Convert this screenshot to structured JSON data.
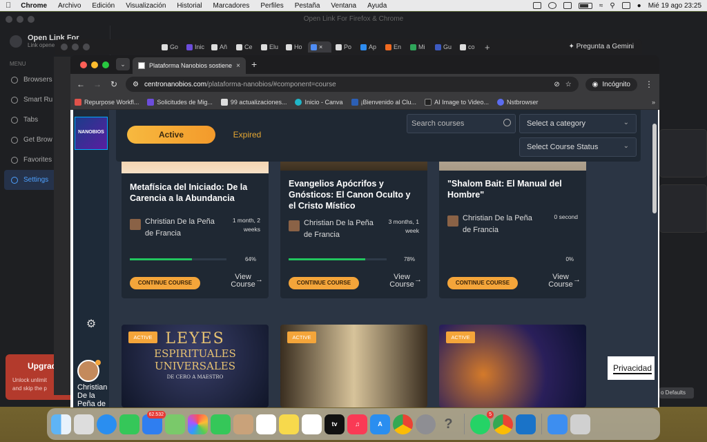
{
  "menubar": {
    "apple": "",
    "app": "Chrome",
    "menus": [
      "Archivo",
      "Edición",
      "Visualización",
      "Historial",
      "Marcadores",
      "Perfiles",
      "Pestaña",
      "Ventana",
      "Ayuda"
    ],
    "clock": "Mié 19 ago  23:25"
  },
  "bg_app": {
    "title": "Open Link For Firefox & Chrome",
    "brand_title": "Open Link For",
    "brand_subtitle": "Link opene",
    "menu_label": "MENU",
    "items": [
      "Browsers",
      "Smart Ru",
      "Tabs",
      "Get Brow",
      "Favorites",
      "Settings"
    ],
    "upgrade_title": "Upgrad",
    "upgrade_desc_1": "Unlock unlimit",
    "upgrade_desc_2": "and skip the p",
    "defaults_btn": "o Defaults"
  },
  "back_window": {
    "tabs": [
      "Go",
      "Inic",
      "Añ",
      "Ce",
      "Elu",
      "Ho",
      "",
      "Po",
      "Ap",
      "En",
      "Mi",
      "Gu",
      "co"
    ],
    "gemini": "Pregunta a Gemini"
  },
  "chrome": {
    "tab_title": "Plataforma Nanobios sostiene",
    "url_host": "centronanobios.com",
    "url_path": "/plataforma-nanobios/#component=course",
    "incognito": "Incógnito",
    "bookmarks": [
      {
        "label": "Repurpose Workfl...",
        "color": "#e0524a"
      },
      {
        "label": "Solicitudes de Mig...",
        "color": "#6c4ddb"
      },
      {
        "label": "99 actualizaciones...",
        "color": "#dddddd"
      },
      {
        "label": "Inicio - Canva",
        "color": "#20b6c8"
      },
      {
        "label": "¡Bienvenido al Clu...",
        "color": "#2c5fb5"
      },
      {
        "label": "AI Image to Video...",
        "color": "#222222"
      },
      {
        "label": "Nstbrowser",
        "color": "#5b6cf0"
      }
    ]
  },
  "lms": {
    "logo": "NANOBIOS",
    "user_name": "Christian De la Peña de",
    "filters": {
      "active": "Active",
      "expired": "Expired",
      "search_placeholder": "Search courses",
      "category": "Select a category",
      "status": "Select Course Status"
    },
    "courses": [
      {
        "title": "Metafísica del Iniciado: De la Carencia a la Abundancia",
        "author": "Christian De la Peña de Francia",
        "duration": "1 month, 2 weeks",
        "progress": 64,
        "progress_label": "64%",
        "continue": "CONTINUE COURSE",
        "view": "View Course"
      },
      {
        "title": "Evangelios Apócrifos y Gnósticos: El Canon Oculto y el Cristo Místico",
        "author": "Christian De la Peña de Francia",
        "duration": "3 months, 1 week",
        "progress": 78,
        "progress_label": "78%",
        "continue": "CONTINUE COURSE",
        "view": "View Course"
      },
      {
        "title": "\"Shalom Bait: El Manual del Hombre\"",
        "author": "Christian De la Peña de Francia",
        "duration": "0 second",
        "progress": 0,
        "progress_label": "0%",
        "continue": "CONTINUE COURSE",
        "view": "View Course"
      }
    ],
    "badge": "ACTIVE",
    "poster_lines": [
      "LEYES",
      "ESPIRITUALES",
      "UNIVERSALES",
      "DE CERO A MAESTRO"
    ]
  },
  "privacy": "Privacidad",
  "dock": {
    "mail_badge": "62.532",
    "whatsapp_badge": "5"
  },
  "colors": {
    "accent": "#f4a53a",
    "progress": "#22c55e",
    "page_bg": "#2b3544",
    "card_bg": "#1f2833"
  }
}
